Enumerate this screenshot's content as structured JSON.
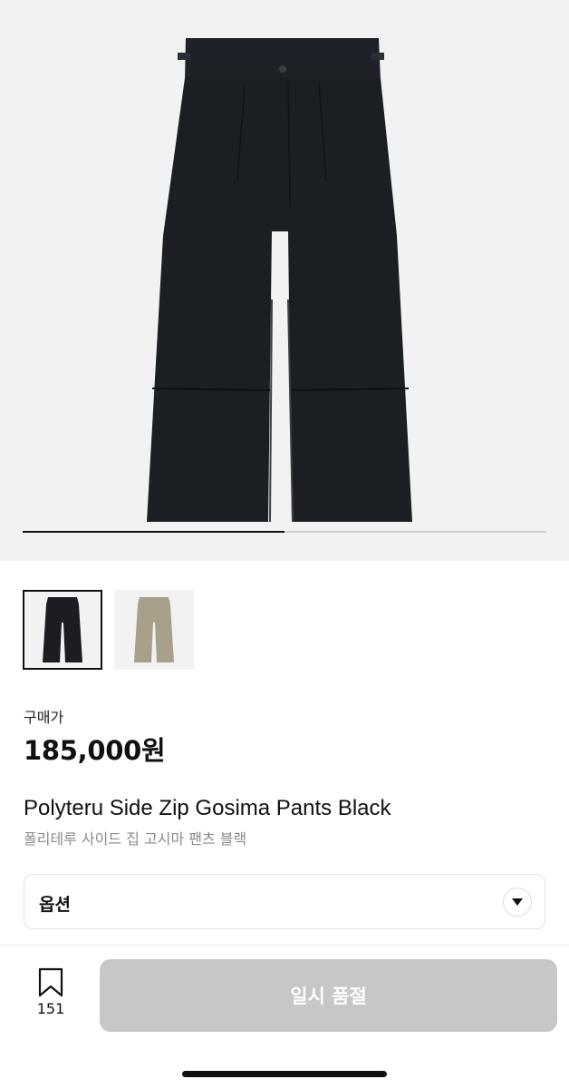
{
  "gallery": {
    "main_image_alt": "Polyteru Side Zip Gosima Pants Black",
    "progress": 0.5,
    "thumbnails": [
      {
        "name": "black",
        "color": "#1b1d22",
        "selected": true
      },
      {
        "name": "beige",
        "color": "#a9a08c",
        "selected": false
      }
    ]
  },
  "product": {
    "price_label": "구매가",
    "price": "185,000원",
    "title_en": "Polyteru Side Zip Gosima Pants Black",
    "title_ko": "폴리테루 사이드 집 고시마 팬츠 블랙"
  },
  "options": {
    "label": "옵션",
    "icon": "triangle-down-icon"
  },
  "bottom_bar": {
    "bookmark_icon": "bookmark-icon",
    "bookmark_count": "151",
    "buy_button_label": "일시 품절",
    "buy_button_color": "#c7c7c7"
  }
}
